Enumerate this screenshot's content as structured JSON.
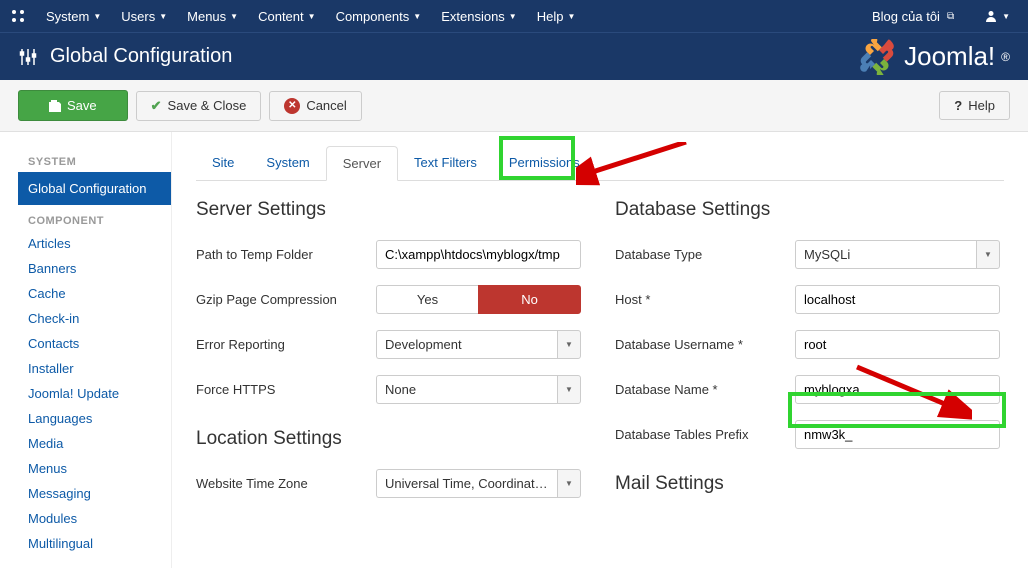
{
  "topbar": {
    "menus": [
      "System",
      "Users",
      "Menus",
      "Content",
      "Components",
      "Extensions",
      "Help"
    ],
    "site_name": "Blog của tôi"
  },
  "header": {
    "title": "Global Configuration",
    "brand": "Joomla!"
  },
  "toolbar": {
    "save": "Save",
    "save_close": "Save & Close",
    "cancel": "Cancel",
    "help": "Help"
  },
  "sidebar": {
    "system_head": "SYSTEM",
    "global": "Global Configuration",
    "component_head": "COMPONENT",
    "items": [
      "Articles",
      "Banners",
      "Cache",
      "Check-in",
      "Contacts",
      "Installer",
      "Joomla! Update",
      "Languages",
      "Media",
      "Menus",
      "Messaging",
      "Modules",
      "Multilingual"
    ]
  },
  "tabs": [
    "Site",
    "System",
    "Server",
    "Text Filters",
    "Permissions"
  ],
  "server_settings": {
    "heading": "Server Settings",
    "path_label": "Path to Temp Folder",
    "path_value": "C:\\xampp\\htdocs\\myblogx/tmp",
    "gzip_label": "Gzip Page Compression",
    "gzip_yes": "Yes",
    "gzip_no": "No",
    "error_label": "Error Reporting",
    "error_value": "Development",
    "https_label": "Force HTTPS",
    "https_value": "None"
  },
  "location": {
    "heading": "Location Settings",
    "tz_label": "Website Time Zone",
    "tz_value": "Universal Time, Coordinated ..."
  },
  "database": {
    "heading": "Database Settings",
    "type_label": "Database Type",
    "type_value": "MySQLi",
    "host_label": "Host *",
    "host_value": "localhost",
    "user_label": "Database Username *",
    "user_value": "root",
    "name_label": "Database Name *",
    "name_value": "myblogxa",
    "prefix_label": "Database Tables Prefix",
    "prefix_value": "nmw3k_"
  },
  "mail": {
    "heading": "Mail Settings"
  }
}
